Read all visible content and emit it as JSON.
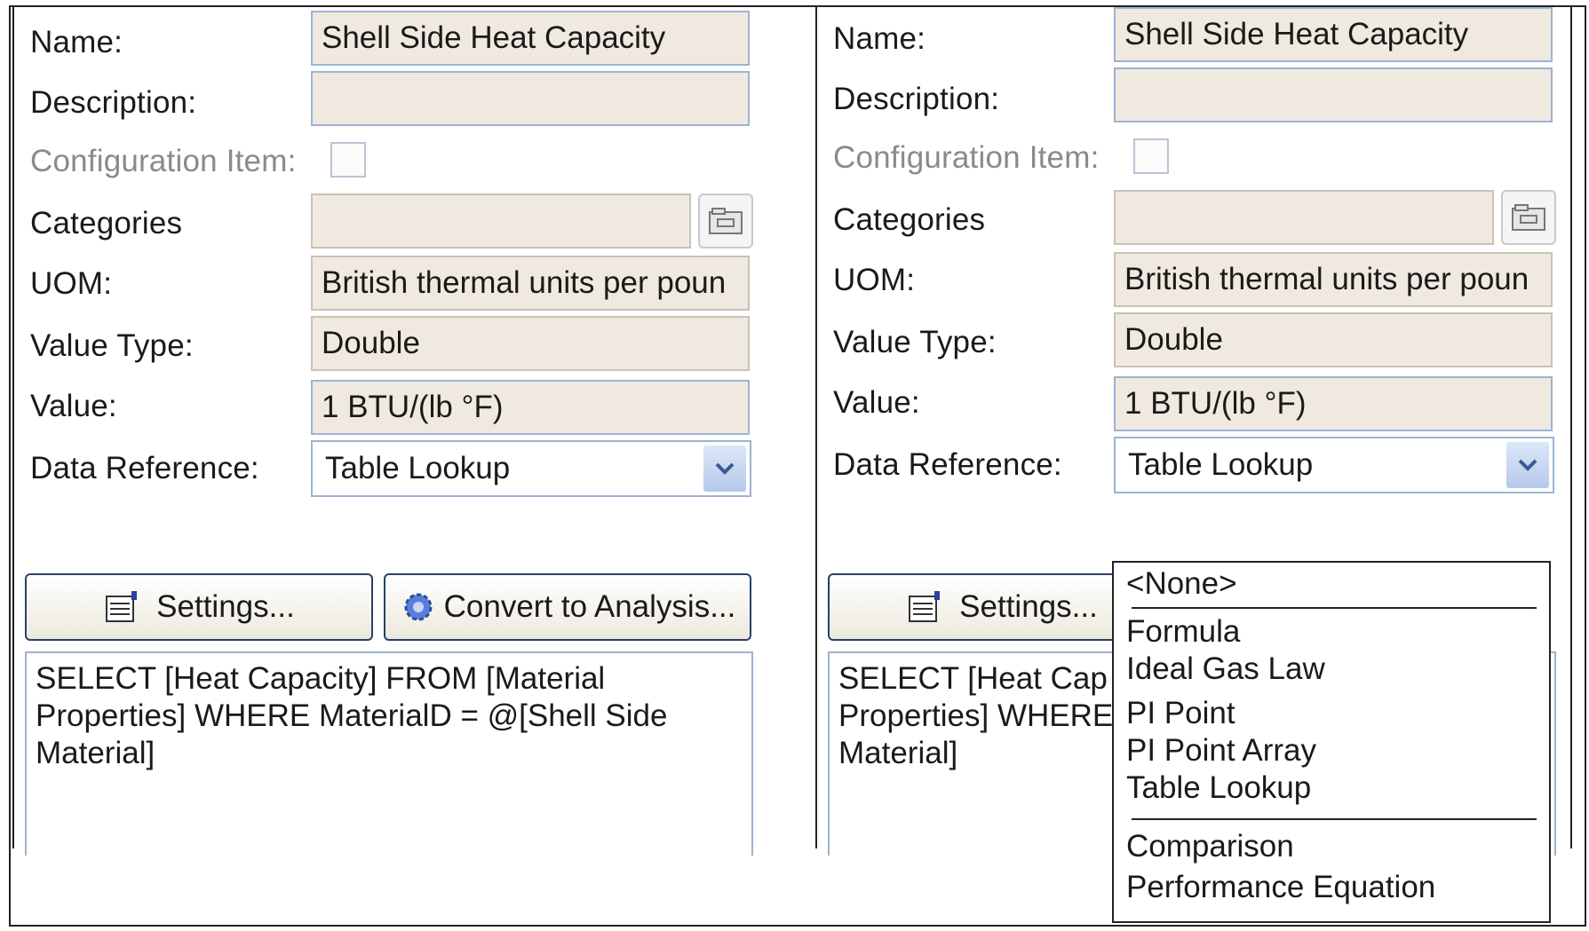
{
  "form": {
    "name_label": "Name:",
    "description_label": "Description:",
    "config_item_label": "Configuration Item:",
    "categories_label": "Categories",
    "uom_label": "UOM:",
    "value_type_label": "Value Type:",
    "value_label": "Value:",
    "data_reference_label": "Data Reference:",
    "name_value": "Shell Side Heat Capacity",
    "description_value": "",
    "categories_value": "",
    "uom_value": "British thermal units per poun",
    "value_type_value": "Double",
    "value_value": "1 BTU/(lb °F)",
    "data_reference_value": "Table Lookup",
    "settings_label": "Settings...",
    "convert_label": "Convert to Analysis...",
    "query_lines": [
      "SELECT [Heat Capacity] FROM [Material",
      "Properties] WHERE MaterialD = @[Shell Side",
      "Material]"
    ],
    "query_lines_truncated": [
      "SELECT [Heat Cap",
      "Properties] WHERE",
      "Material]"
    ]
  },
  "dropdown": {
    "items": [
      "<None>",
      "Formula",
      "Ideal Gas Law",
      "PI Point",
      "PI Point Array",
      "Table Lookup",
      "Comparison",
      "Performance Equation"
    ]
  },
  "icons": {
    "settings": "settings-sheet-icon",
    "convert": "gear-icon",
    "browse": "folder-icon",
    "dropdown": "chevron-down-icon"
  },
  "colors": {
    "field_bg": "#f0e9df",
    "field_border": "#9cb3d4",
    "button_border": "#29406a"
  }
}
